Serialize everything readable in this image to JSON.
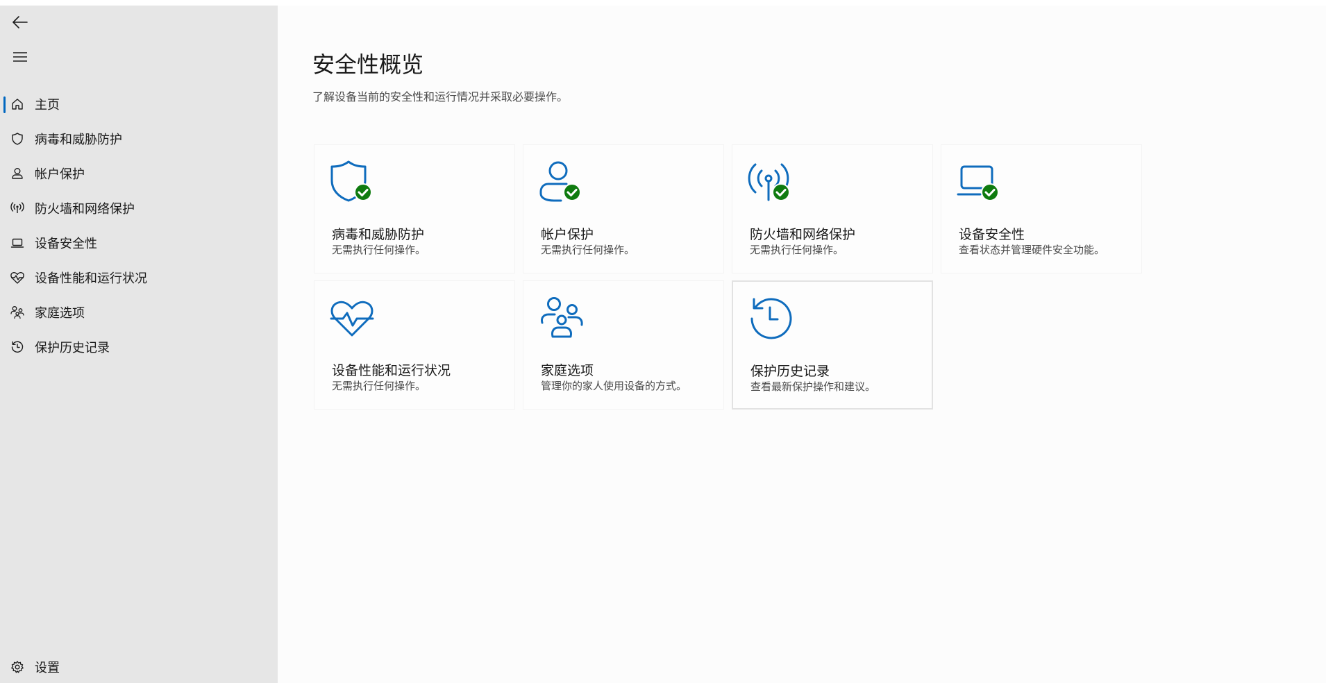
{
  "sidebar": {
    "back_icon": "back-arrow-icon",
    "menu_icon": "hamburger-icon",
    "items": [
      {
        "label": "主页",
        "icon": "home-icon",
        "active": true
      },
      {
        "label": "病毒和威胁防护",
        "icon": "shield-icon"
      },
      {
        "label": "帐户保护",
        "icon": "person-icon"
      },
      {
        "label": "防火墙和网络保护",
        "icon": "antenna-icon"
      },
      {
        "label": "设备安全性",
        "icon": "laptop-icon"
      },
      {
        "label": "设备性能和运行状况",
        "icon": "heart-pulse-icon"
      },
      {
        "label": "家庭选项",
        "icon": "family-icon"
      },
      {
        "label": "保护历史记录",
        "icon": "history-icon"
      }
    ],
    "settings": {
      "label": "设置",
      "icon": "gear-icon"
    }
  },
  "main": {
    "title": "安全性概览",
    "subtitle": "了解设备当前的安全性和运行情况并采取必要操作。"
  },
  "cards": [
    {
      "title": "病毒和威胁防护",
      "desc": "无需执行任何操作。",
      "icon": "shield-check-icon",
      "status": "ok"
    },
    {
      "title": "帐户保护",
      "desc": "无需执行任何操作。",
      "icon": "person-check-icon",
      "status": "ok"
    },
    {
      "title": "防火墙和网络保护",
      "desc": "无需执行任何操作。",
      "icon": "antenna-check-icon",
      "status": "ok"
    },
    {
      "title": "设备安全性",
      "desc": "查看状态并管理硬件安全功能。",
      "icon": "laptop-check-icon",
      "status": "ok"
    },
    {
      "title": "设备性能和运行状况",
      "desc": "无需执行任何操作。",
      "icon": "heart-pulse-icon"
    },
    {
      "title": "家庭选项",
      "desc": "管理你的家人使用设备的方式。",
      "icon": "family-icon"
    },
    {
      "title": "保护历史记录",
      "desc": "查看最新保护操作和建议。",
      "icon": "history-icon"
    }
  ],
  "colors": {
    "accent": "#0067c0",
    "icon_blue": "#0f6cbd",
    "status_ok": "#0f7b0f",
    "sidebar_bg": "#e6e6e6"
  }
}
